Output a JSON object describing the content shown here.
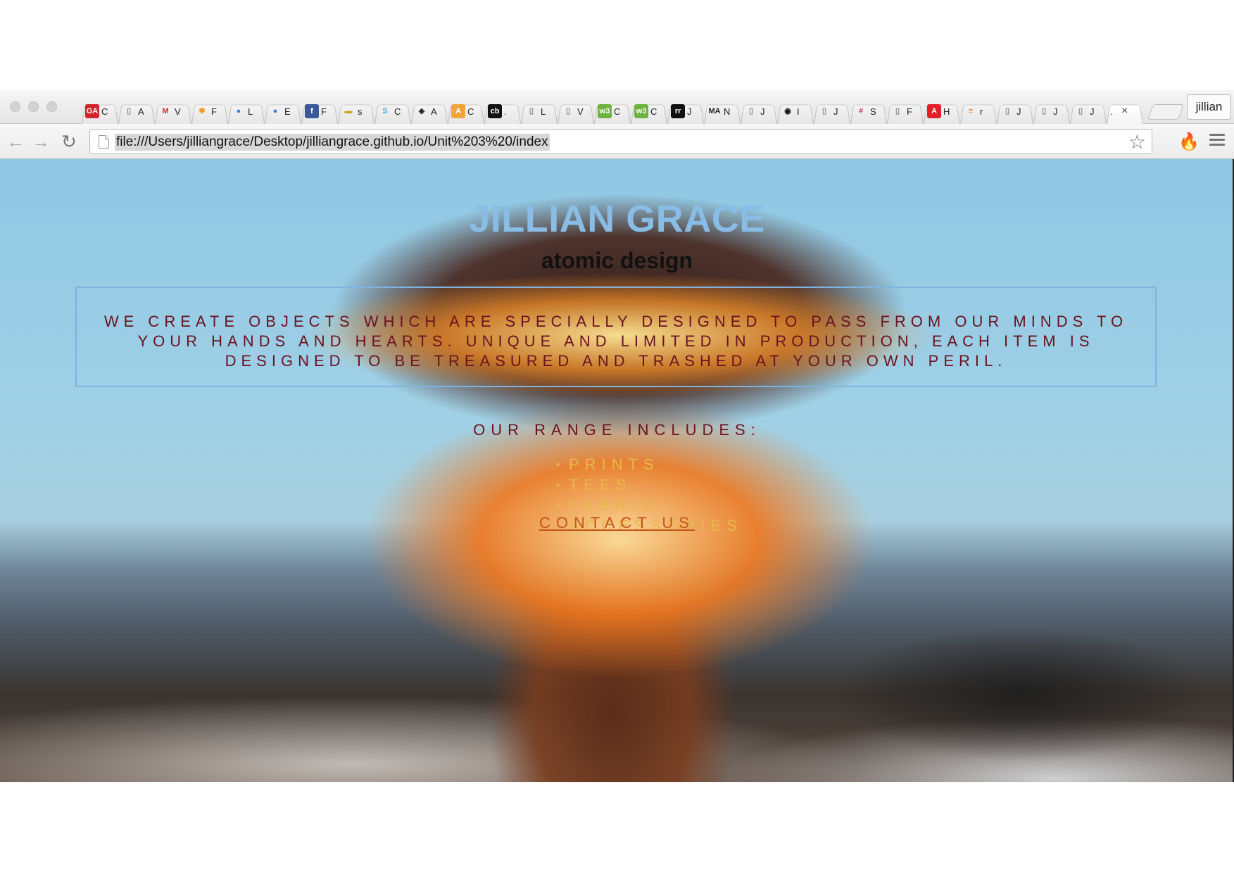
{
  "browser": {
    "tabs": [
      {
        "icon": "ga-icon",
        "glyph": "GA",
        "label": "C",
        "color": "#d0232b",
        "fg": "#ffffff"
      },
      {
        "icon": "page-icon",
        "glyph": "▯",
        "label": "A",
        "color": "transparent",
        "fg": "#888888"
      },
      {
        "icon": "gmail-icon",
        "glyph": "M",
        "label": "V",
        "color": "transparent",
        "fg": "#c5332a"
      },
      {
        "icon": "asterisk-icon",
        "glyph": "✱",
        "label": "F",
        "color": "transparent",
        "fg": "#f29a1d"
      },
      {
        "icon": "video-icon",
        "glyph": "●",
        "label": "L",
        "color": "transparent",
        "fg": "#3b7ddc"
      },
      {
        "icon": "video-icon",
        "glyph": "●",
        "label": "E",
        "color": "transparent",
        "fg": "#3b7ddc"
      },
      {
        "icon": "facebook-icon",
        "glyph": "f",
        "label": "F",
        "color": "#3b5998",
        "fg": "#ffffff"
      },
      {
        "icon": "imdb-icon",
        "glyph": "▬",
        "label": "s",
        "color": "transparent",
        "fg": "#c9a21b"
      },
      {
        "icon": "s-logo-icon",
        "glyph": "S",
        "label": "C",
        "color": "transparent",
        "fg": "#37a8d4"
      },
      {
        "icon": "codepen-icon",
        "glyph": "◈",
        "label": "A",
        "color": "transparent",
        "fg": "#222222"
      },
      {
        "icon": "a-circle-icon",
        "glyph": "A",
        "label": "C",
        "color": "#f2a43a",
        "fg": "#ffffff"
      },
      {
        "icon": "cb-icon",
        "glyph": "cb",
        "label": ".",
        "color": "#111111",
        "fg": "#ffffff"
      },
      {
        "icon": "page-icon",
        "glyph": "▯",
        "label": "L",
        "color": "transparent",
        "fg": "#888888"
      },
      {
        "icon": "page-icon",
        "glyph": "▯",
        "label": "V",
        "color": "transparent",
        "fg": "#888888"
      },
      {
        "icon": "w3-icon",
        "glyph": "w3",
        "label": "C",
        "color": "#6cb33f",
        "fg": "#ffffff"
      },
      {
        "icon": "w3-icon",
        "glyph": "w3",
        "label": "C",
        "color": "#6cb33f",
        "fg": "#ffffff"
      },
      {
        "icon": "rr-icon",
        "glyph": "rr",
        "label": "J",
        "color": "#111111",
        "fg": "#ffffff"
      },
      {
        "icon": "ma-icon",
        "glyph": "MA",
        "label": "N",
        "color": "transparent",
        "fg": "#222222"
      },
      {
        "icon": "page-icon",
        "glyph": "▯",
        "label": "J",
        "color": "transparent",
        "fg": "#888888"
      },
      {
        "icon": "record-icon",
        "glyph": "◉",
        "label": "I",
        "color": "transparent",
        "fg": "#111111"
      },
      {
        "icon": "page-icon",
        "glyph": "▯",
        "label": "J",
        "color": "transparent",
        "fg": "#888888"
      },
      {
        "icon": "slack-icon",
        "glyph": "#",
        "label": "S",
        "color": "transparent",
        "fg": "#d6336c"
      },
      {
        "icon": "page-icon",
        "glyph": "▯",
        "label": "F",
        "color": "transparent",
        "fg": "#888888"
      },
      {
        "icon": "adobe-icon",
        "glyph": "A",
        "label": "H",
        "color": "#e31e24",
        "fg": "#ffffff"
      },
      {
        "icon": "stack-icon",
        "glyph": "≡",
        "label": "r",
        "color": "transparent",
        "fg": "#f48024"
      },
      {
        "icon": "page-icon",
        "glyph": "▯",
        "label": "J",
        "color": "transparent",
        "fg": "#888888"
      },
      {
        "icon": "page-icon",
        "glyph": "▯",
        "label": "J",
        "color": "transparent",
        "fg": "#888888"
      },
      {
        "icon": "page-icon",
        "glyph": "▯",
        "label": "J",
        "color": "transparent",
        "fg": "#888888"
      }
    ],
    "active_tab": {
      "label": ".",
      "close": "×"
    },
    "profile_name": "jillian",
    "url": "file:///Users/jilliangrace/Desktop/jilliangrace.github.io/Unit%203%20/index",
    "icons": {
      "back": "←",
      "forward": "→",
      "reload": "↻",
      "star": "☆",
      "extension": "🔥"
    }
  },
  "page": {
    "title": "JILLIAN GRACE",
    "subtitle": "atomic design",
    "about": "WE CREATE OBJECTS WHICH ARE SPECIALLY DESIGNED TO PASS FROM OUR MINDS TO YOUR HANDS AND HEARTS. UNIQUE AND LIMITED IN PRODUCTION, EACH ITEM IS DESIGNED TO BE TREASURED AND TRASHED AT YOUR OWN PERIL.",
    "range_heading": "OUR RANGE INCLUDES:",
    "range_items": [
      "PRINTS",
      "TEES",
      "FABRIC",
      "ACCESSORIES"
    ],
    "bullet": "•",
    "contact_label": "CONTACT US",
    "colors": {
      "title": "#89bde6",
      "body_text": "#6b1220",
      "list_text": "#e8b84a",
      "link": "#c4541c",
      "box_border": "#7fb3e2"
    }
  }
}
